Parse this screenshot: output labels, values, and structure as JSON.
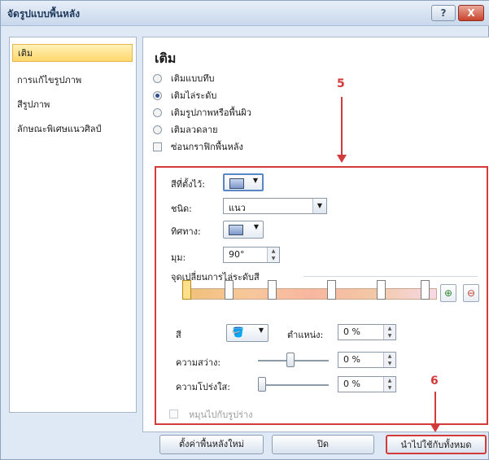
{
  "window": {
    "title": "จัดรูปแบบพื้นหลัง",
    "help_label": "?",
    "close_label": "X"
  },
  "sidebar": {
    "items": [
      {
        "label": "เติม",
        "selected": true
      },
      {
        "label": "การแก้ไขรูปภาพ"
      },
      {
        "label": "สีรูปภาพ"
      },
      {
        "label": "ลักษณะพิเศษแนวศิลป์"
      }
    ]
  },
  "main": {
    "heading": "เติม",
    "fill_options": [
      {
        "label": "เติมแบบทึบ",
        "selected": false
      },
      {
        "label": "เติมไล่ระดับ",
        "selected": true
      },
      {
        "label": "เติมรูปภาพหรือพื้นผิว",
        "selected": false
      },
      {
        "label": "เติมลวดลาย",
        "selected": false
      }
    ],
    "hide_background_label": "ซ่อนกราฟิกพื้นหลัง",
    "preset_colors_label": "สีที่ตั้งไว้:",
    "type_label": "ชนิด:",
    "type_value": "แนว",
    "direction_label": "ทิศทาง:",
    "angle_label": "มุม:",
    "angle_value": "90°",
    "gradient_stops_label": "จุดเปลี่ยนการไล่ระดับสี",
    "color_label": "สี",
    "position_label": "ตำแหน่ง:",
    "position_value": "0 %",
    "brightness_label": "ความสว่าง:",
    "brightness_value": "0 %",
    "transparency_label": "ความโปร่งใส:",
    "transparency_value": "0 %",
    "rotate_with_shape_label": "หมุนไปกับรูปร่าง"
  },
  "footer": {
    "reset_label": "ตั้งค่าพื้นหลังใหม่",
    "close_label": "ปิด",
    "apply_all_label": "นำไปใช้กับทั้งหมด"
  },
  "annotations": {
    "marker_5": "5",
    "marker_6": "6"
  },
  "colors": {
    "annotation_red": "#d33a3a",
    "selected_item": "#ffd86b"
  }
}
